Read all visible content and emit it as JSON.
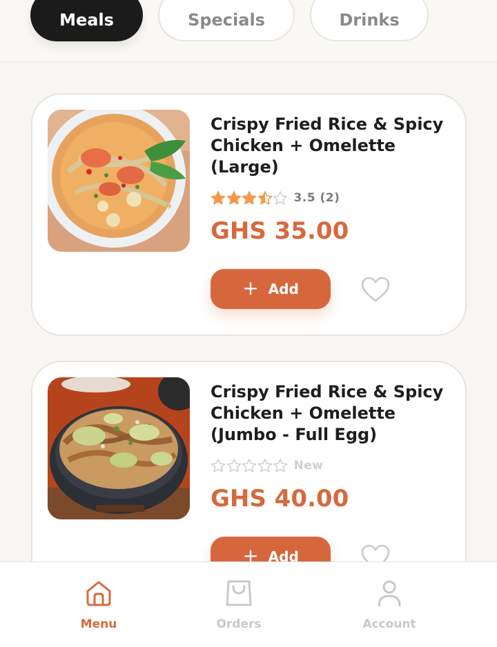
{
  "tabs": [
    {
      "label": "Meals",
      "active": true
    },
    {
      "label": "Specials",
      "active": false
    },
    {
      "label": "Drinks",
      "active": false
    }
  ],
  "items": [
    {
      "title": "Crispy Fried Rice & Spicy Chicken + Omelette (Large)",
      "rating": 3.5,
      "rating_text": "3.5 (2)",
      "price": "GHS 35.00",
      "add_label": "Add",
      "image": "noodle-soup-bowl"
    },
    {
      "title": "Crispy Fried Rice & Spicy Chicken + Omelette (Jumbo - Full Egg)",
      "rating": 0,
      "rating_text": "New",
      "price": "GHS 40.00",
      "add_label": "Add",
      "image": "stir-fry-noodles-pot"
    }
  ],
  "nav": [
    {
      "label": "Menu",
      "icon": "home-icon",
      "active": true
    },
    {
      "label": "Orders",
      "icon": "shopping-bag-icon",
      "active": false
    },
    {
      "label": "Account",
      "icon": "user-icon",
      "active": false
    }
  ],
  "colors": {
    "accent": "#d6673d",
    "star_filled": "#f2994a",
    "star_empty": "#d0d0d0",
    "tab_active_bg": "#1b1b1b"
  }
}
